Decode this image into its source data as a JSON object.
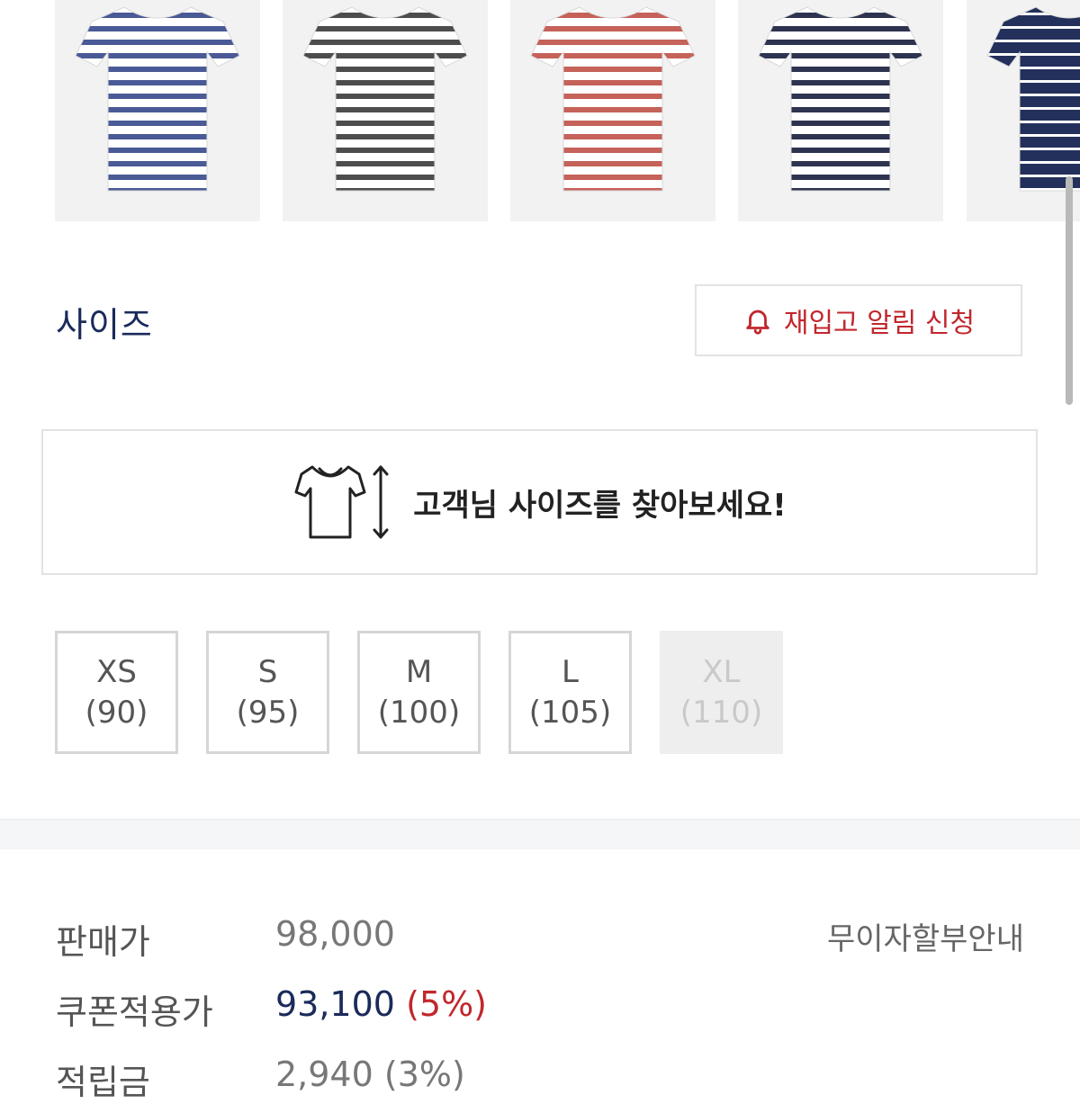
{
  "thumbnails": [
    {
      "name": "tshirt-blue-stripe",
      "stripe_color": "#4a5a96"
    },
    {
      "name": "tshirt-gray-stripe",
      "stripe_color": "#4d4d4d"
    },
    {
      "name": "tshirt-red-stripe",
      "stripe_color": "#c5625a"
    },
    {
      "name": "tshirt-navy-stripe",
      "stripe_color": "#2e3350"
    },
    {
      "name": "tshirt-white-stripe-on-navy",
      "stripe_color": "#23305c"
    }
  ],
  "size_section": {
    "title": "사이즈",
    "restock_button": {
      "label": "재입고 알림 신청",
      "icon": "bell-icon"
    },
    "size_finder": {
      "label": "고객님 사이즈를 찾아보세요!",
      "icon": "tshirt-size-icon"
    },
    "sizes": [
      {
        "label": "XS",
        "sub": "(90)",
        "available": true
      },
      {
        "label": "S",
        "sub": "(95)",
        "available": true
      },
      {
        "label": "M",
        "sub": "(100)",
        "available": true
      },
      {
        "label": "L",
        "sub": "(105)",
        "available": true
      },
      {
        "label": "XL",
        "sub": "(110)",
        "available": false
      }
    ]
  },
  "pricing": {
    "sale_price": {
      "label": "판매가",
      "value": "98,000"
    },
    "coupon_price": {
      "label": "쿠폰적용가",
      "value": "93,100",
      "rate": "(5%)"
    },
    "points": {
      "label": "적립금",
      "value": "2,940 (3%)"
    },
    "installment_link": "무이자할부안내"
  },
  "colors": {
    "accent_red": "#c1272d",
    "navy": "#1a2a5a"
  }
}
